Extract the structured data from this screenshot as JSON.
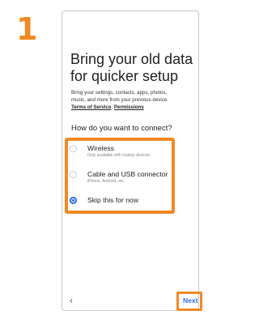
{
  "step": {
    "number": "1",
    "color": "#f08a24"
  },
  "screen": {
    "title_line1": "Bring your old data",
    "title_line2": "for quicker setup",
    "description_line1": "Bring your settings, contacts, apps, photos,",
    "description_line2": "music, and more from your previous device.",
    "terms_link": "Terms of Service",
    "terms_separator": ",",
    "permissions_link": "Permissions",
    "question": "How do you want to connect?"
  },
  "options": [
    {
      "label": "Wireless",
      "sublabel": "Only available with Galaxy devices.",
      "selected": false
    },
    {
      "label": "Cable and USB connector",
      "sublabel": "iPhone, Android, etc.",
      "selected": false
    },
    {
      "label": "Skip this for now",
      "sublabel": "",
      "selected": true
    }
  ],
  "nav": {
    "back_icon": "chevron-left-icon",
    "back_glyph": "‹",
    "next_label": "Next"
  },
  "colors": {
    "highlight": "#f08a24",
    "accent": "#2e6ef0"
  }
}
